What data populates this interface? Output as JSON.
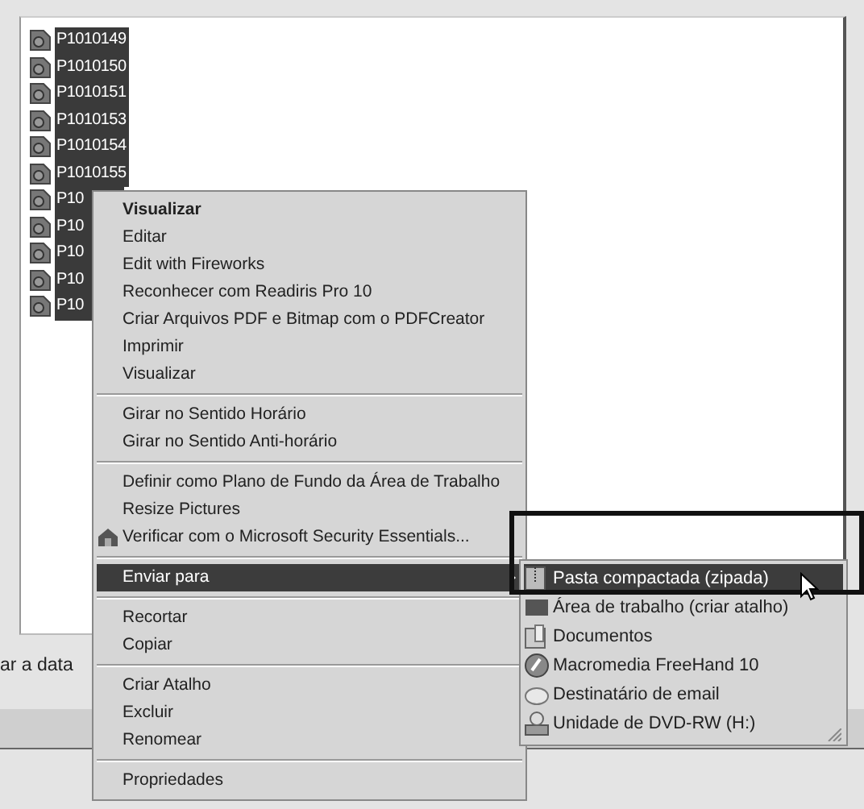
{
  "file_list": [
    {
      "name": "P1010149",
      "selected": true
    },
    {
      "name": "P1010150",
      "selected": true
    },
    {
      "name": "P1010151",
      "selected": true
    },
    {
      "name": "P1010153",
      "selected": true
    },
    {
      "name": "P1010154",
      "selected": true
    },
    {
      "name": "P1010155",
      "selected": true
    },
    {
      "name": "P10",
      "selected": true
    },
    {
      "name": "P10",
      "selected": true
    },
    {
      "name": "P10",
      "selected": true
    },
    {
      "name": "P10",
      "selected": true
    },
    {
      "name": "P10",
      "selected": true
    }
  ],
  "status_text": "ar a data",
  "context_menu": {
    "groups": [
      [
        {
          "label": "Visualizar",
          "default": true,
          "selected": false
        },
        {
          "label": "Editar",
          "default": false,
          "selected": false
        },
        {
          "label": "Edit with Fireworks",
          "default": false,
          "selected": false
        },
        {
          "label": "Reconhecer com Readiris Pro 10",
          "default": false,
          "selected": false
        },
        {
          "label": "Criar Arquivos PDF e Bitmap com o PDFCreator",
          "default": false,
          "selected": false
        },
        {
          "label": "Imprimir",
          "default": false,
          "selected": false
        },
        {
          "label": "Visualizar",
          "default": false,
          "selected": false
        }
      ],
      [
        {
          "label": "Girar no Sentido Horário",
          "default": false,
          "selected": false
        },
        {
          "label": "Girar no Sentido Anti-horário",
          "default": false,
          "selected": false
        }
      ],
      [
        {
          "label": "Definir como Plano de Fundo da Área de Trabalho",
          "default": false,
          "selected": false
        },
        {
          "label": "Resize Pictures",
          "default": false,
          "selected": false
        },
        {
          "label": "Verificar com o Microsoft Security Essentials...",
          "default": false,
          "selected": false,
          "has_icon": true
        }
      ],
      [
        {
          "label": "Enviar para",
          "default": false,
          "selected": true,
          "has_submenu": true
        }
      ],
      [
        {
          "label": "Recortar",
          "default": false,
          "selected": false
        },
        {
          "label": "Copiar",
          "default": false,
          "selected": false
        }
      ],
      [
        {
          "label": "Criar Atalho",
          "default": false,
          "selected": false
        },
        {
          "label": "Excluir",
          "default": false,
          "selected": false
        },
        {
          "label": "Renomear",
          "default": false,
          "selected": false
        }
      ],
      [
        {
          "label": "Propriedades",
          "default": false,
          "selected": false
        }
      ]
    ]
  },
  "submenu": {
    "items": [
      {
        "label": "Pasta compactada (zipada)",
        "kind": "zip",
        "selected": true
      },
      {
        "label": "Área de trabalho (criar atalho)",
        "kind": "desktop",
        "selected": false
      },
      {
        "label": "Documentos",
        "kind": "documents",
        "selected": false
      },
      {
        "label": "Macromedia FreeHand 10",
        "kind": "app",
        "selected": false
      },
      {
        "label": "Destinatário de email",
        "kind": "mail",
        "selected": false
      },
      {
        "label": "Unidade de DVD-RW (H:)",
        "kind": "drive",
        "selected": false
      }
    ]
  }
}
